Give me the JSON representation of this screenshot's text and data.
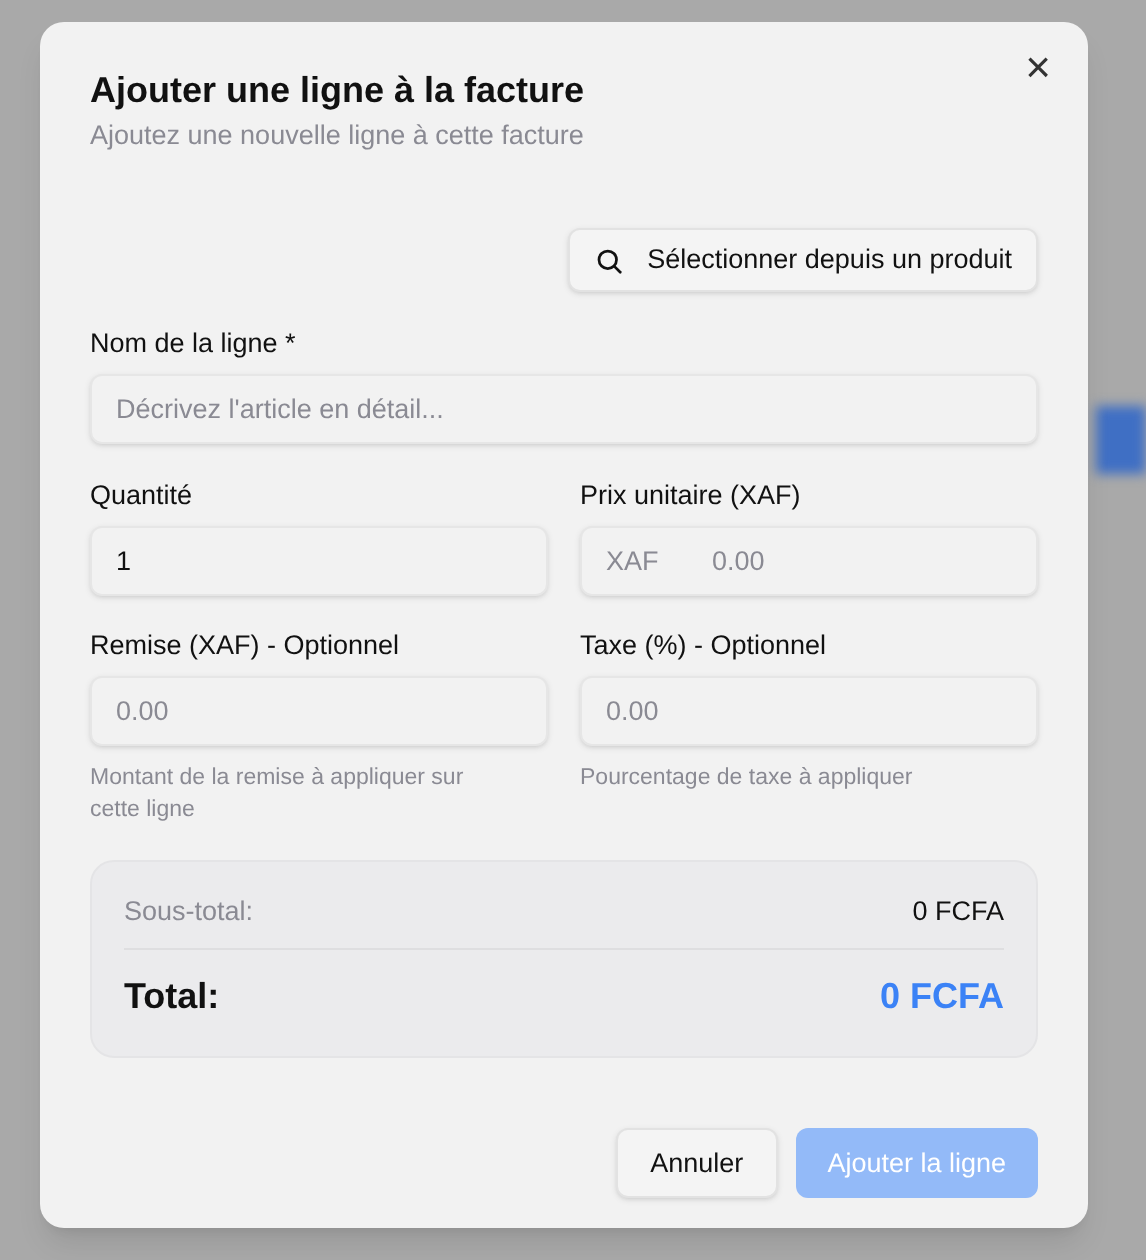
{
  "dialog": {
    "title": "Ajouter une ligne à la facture",
    "subtitle": "Ajoutez une nouvelle ligne à cette facture",
    "close_label": "×"
  },
  "product_button": {
    "label": "Sélectionner depuis un produit"
  },
  "name_field": {
    "label": "Nom de la ligne *",
    "placeholder": "Décrivez l'article en détail..."
  },
  "fields": [
    {
      "label": "Quantité",
      "value": "1"
    },
    {
      "label": "Prix unitaire (XAF)",
      "prefix": "XAF",
      "placeholder": "0.00"
    },
    {
      "label": "Remise (XAF) - Optionnel",
      "placeholder": "0.00",
      "help": "Montant de la remise à appliquer sur cette ligne"
    },
    {
      "label": "Taxe (%) - Optionnel",
      "placeholder": "0.00",
      "help": "Pourcentage de taxe à appliquer"
    }
  ],
  "summary": {
    "subtotal_label": "Sous-total:",
    "subtotal": "0 FCFA",
    "total_label": "Total:",
    "total": "0 FCFA"
  },
  "buttons": [
    {
      "label": "Annuler",
      "kind": "secondary",
      "disabled": false
    },
    {
      "label": "Ajouter la ligne",
      "kind": "primary",
      "disabled": true
    }
  ]
}
